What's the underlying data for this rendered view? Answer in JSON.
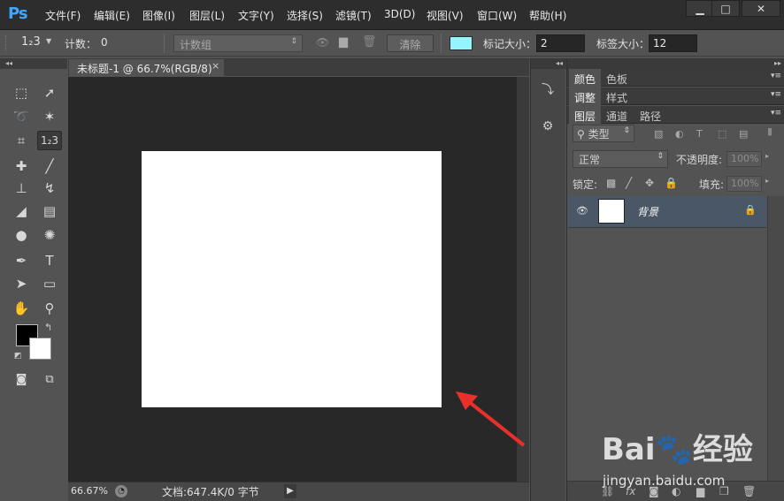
{
  "app": {
    "logo": "Ps",
    "menu": [
      "文件(F)",
      "编辑(E)",
      "图像(I)",
      "图层(L)",
      "文字(Y)",
      "选择(S)",
      "滤镜(T)",
      "3D(D)",
      "视图(V)",
      "窗口(W)",
      "帮助(H)"
    ],
    "window_controls": {
      "minimize": "▁",
      "maximize": "□",
      "close": "✕"
    }
  },
  "options_bar": {
    "tool_icon": "1₂3",
    "count_label": "计数：",
    "count_value": "0",
    "count_group_placeholder": "计数组",
    "clear_button": "清除",
    "mark_color": "#94f4ff",
    "mark_size_label": "标记大小：",
    "mark_size_value": "2",
    "label_size_label": "标签大小：",
    "label_size_value": "12"
  },
  "document": {
    "tab_title": "未标题-1 @ 66.7%(RGB/8)",
    "tab_close": "×",
    "canvas_color": "#ffffff",
    "status_zoom": "66.67%",
    "status_info": "文档:647.4K/0 字节"
  },
  "toolbar": {
    "foreground_color": "#000000",
    "background_color": "#ffffff"
  },
  "panels": {
    "group1_tabs": [
      "颜色",
      "色板"
    ],
    "group2_tabs": [
      "调整",
      "样式"
    ],
    "group3_tabs": [
      "图层",
      "通道",
      "路径"
    ],
    "filter_kind": "类型",
    "blend_mode": "正常",
    "opacity_label": "不透明度:",
    "opacity_value": "100%",
    "lock_label": "锁定:",
    "fill_label": "填充:",
    "fill_value": "100%",
    "layers": [
      {
        "name": "背景",
        "visible": true,
        "locked": true
      }
    ]
  },
  "watermark": {
    "logo_text": "Bai🐾经验",
    "url": "jingyan.baidu.com"
  }
}
